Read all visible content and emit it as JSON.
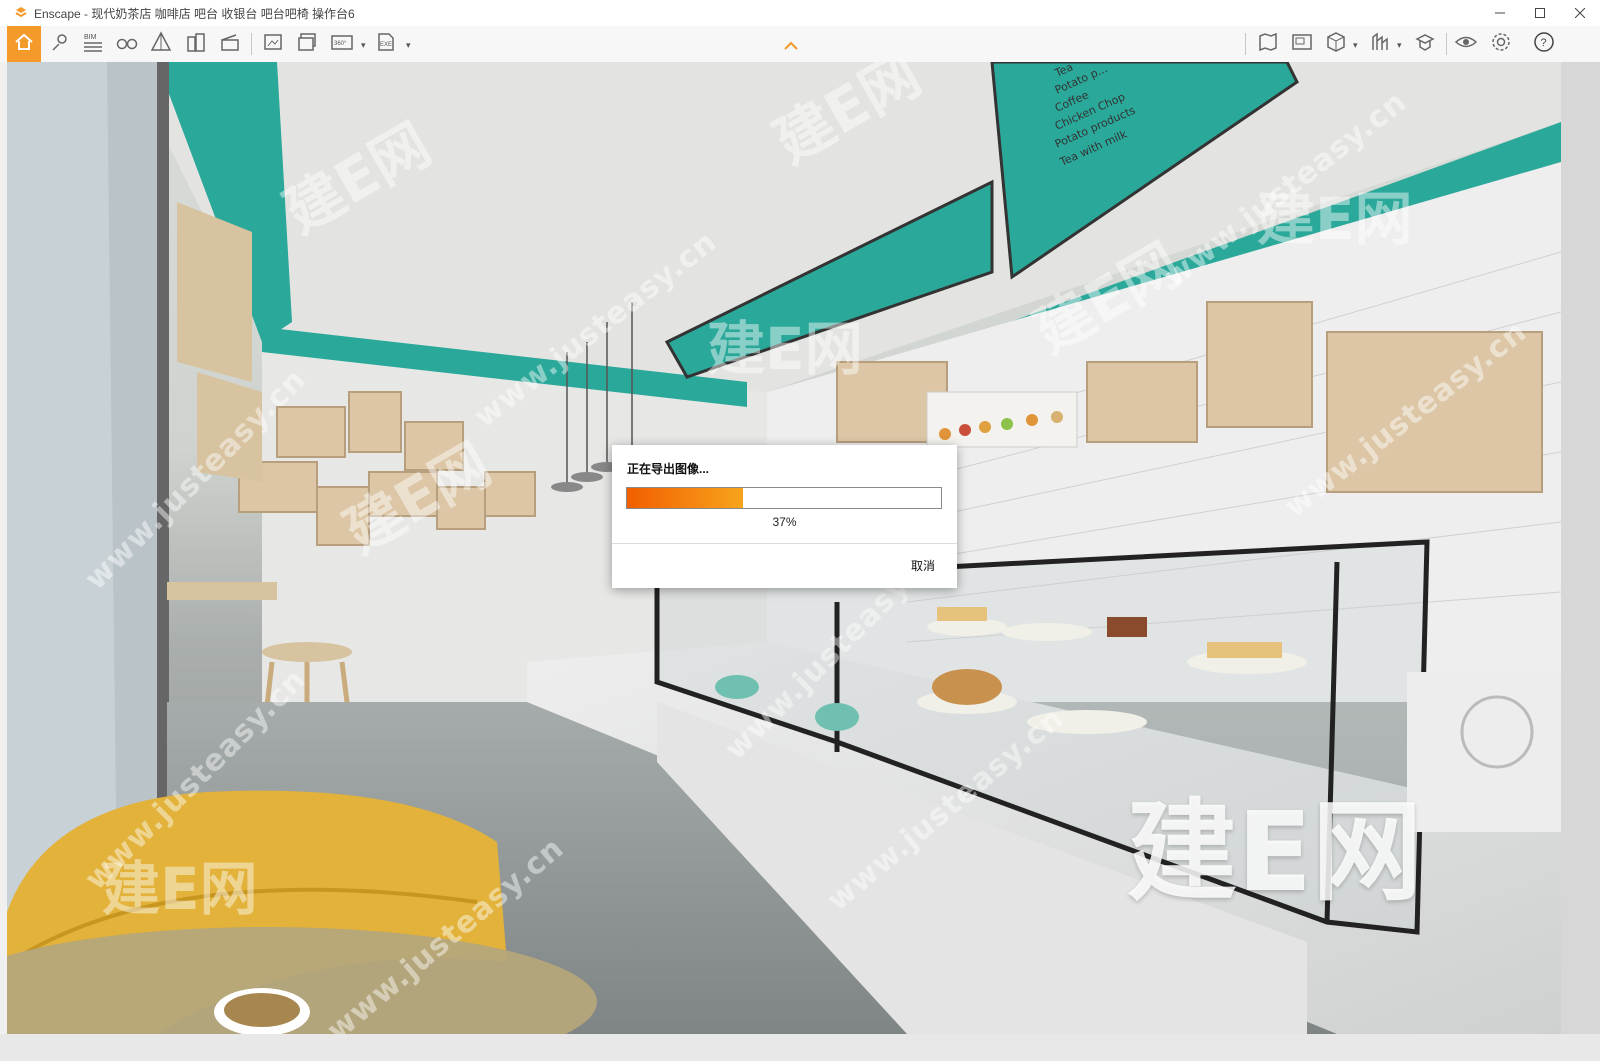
{
  "window": {
    "title": "Enscape - 现代奶茶店 咖啡店 吧台 收银台 吧台吧椅 操作台6"
  },
  "toolbar": {
    "bim_label": "BIM",
    "pano_label": "360°",
    "exe_label": "EXE"
  },
  "dialog": {
    "title": "正在导出图像...",
    "percent_text": "37%",
    "progress": 0.37,
    "cancel_label": "取消"
  },
  "scene": {
    "menu_board_text": [
      "Tea",
      "Potato p...",
      "Coffee",
      "Chicken Chop",
      "Potato products",
      "Tea with milk"
    ]
  },
  "watermark": {
    "url_text": "www.justeasy.cn",
    "logo_text": "建E网"
  },
  "colors": {
    "accent": "#f39a2b",
    "teal": "#2aa89a",
    "progress_start": "#f25e00",
    "progress_end": "#f7a41c"
  }
}
